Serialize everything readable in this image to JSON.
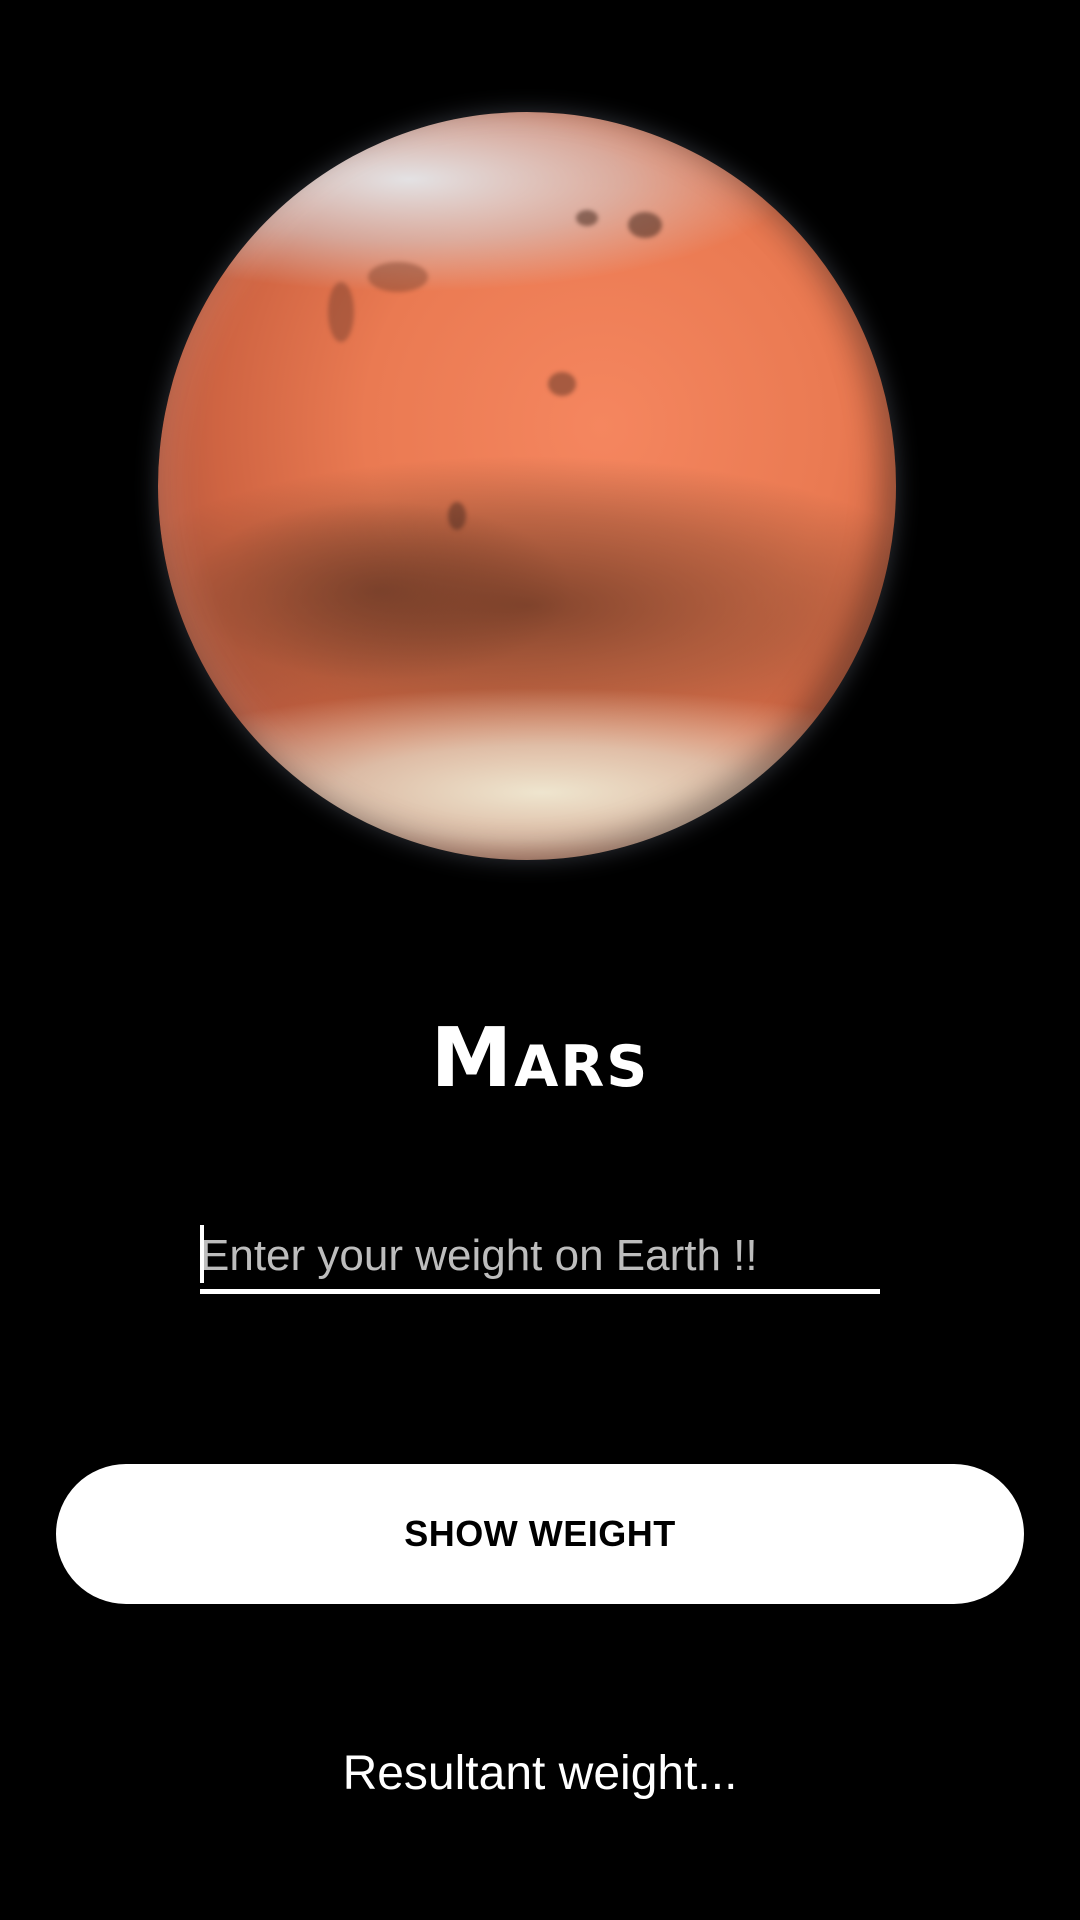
{
  "planet": {
    "image": "mars-planet-image",
    "name": "Mars"
  },
  "weight_input": {
    "placeholder": "Enter your weight on Earth !!",
    "value": ""
  },
  "show_button": {
    "label": "SHOW WEIGHT"
  },
  "result": {
    "text": "Resultant weight..."
  },
  "colors": {
    "background": "#000000",
    "text": "#ffffff",
    "button_bg": "#ffffff",
    "button_text": "#000000",
    "placeholder": "#bdbdbd",
    "planet": "#ea7a52"
  }
}
